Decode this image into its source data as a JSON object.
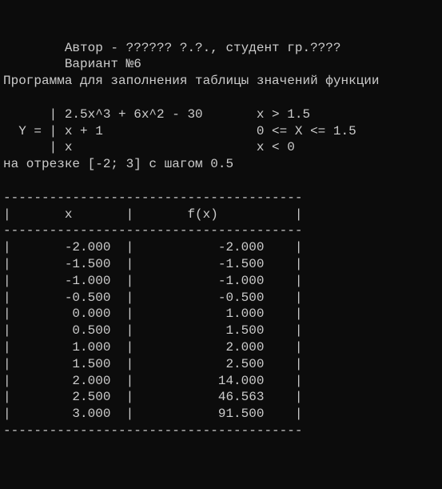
{
  "header": {
    "author_line": "        Автор - ?????? ?.?., студент гр.????",
    "variant_line": "        Вариант №6",
    "program_desc": "Программа для заполнения таблицы значений функции",
    "blank": ""
  },
  "piecewise": {
    "row1": "      | 2.5x^3 + 6x^2 - 30       x > 1.5",
    "row2": "  Y = | x + 1                    0 <= X <= 1.5",
    "row3": "      | x                        x < 0"
  },
  "interval": "на отрезке [-2; 3] c шагом 0.5",
  "divider": "---------------------------------------",
  "tbl_header": "|       x       |       f(x)          |",
  "chart_data": {
    "type": "table",
    "columns": [
      "x",
      "f(x)"
    ],
    "rows": [
      {
        "x": "-2.000",
        "fx": "-2.000"
      },
      {
        "x": "-1.500",
        "fx": "-1.500"
      },
      {
        "x": "-1.000",
        "fx": "-1.000"
      },
      {
        "x": "-0.500",
        "fx": "-0.500"
      },
      {
        "x": "0.000",
        "fx": "1.000"
      },
      {
        "x": "0.500",
        "fx": "1.500"
      },
      {
        "x": "1.000",
        "fx": "2.000"
      },
      {
        "x": "1.500",
        "fx": "2.500"
      },
      {
        "x": "2.000",
        "fx": "14.000"
      },
      {
        "x": "2.500",
        "fx": "46.563"
      },
      {
        "x": "3.000",
        "fx": "91.500"
      }
    ]
  }
}
